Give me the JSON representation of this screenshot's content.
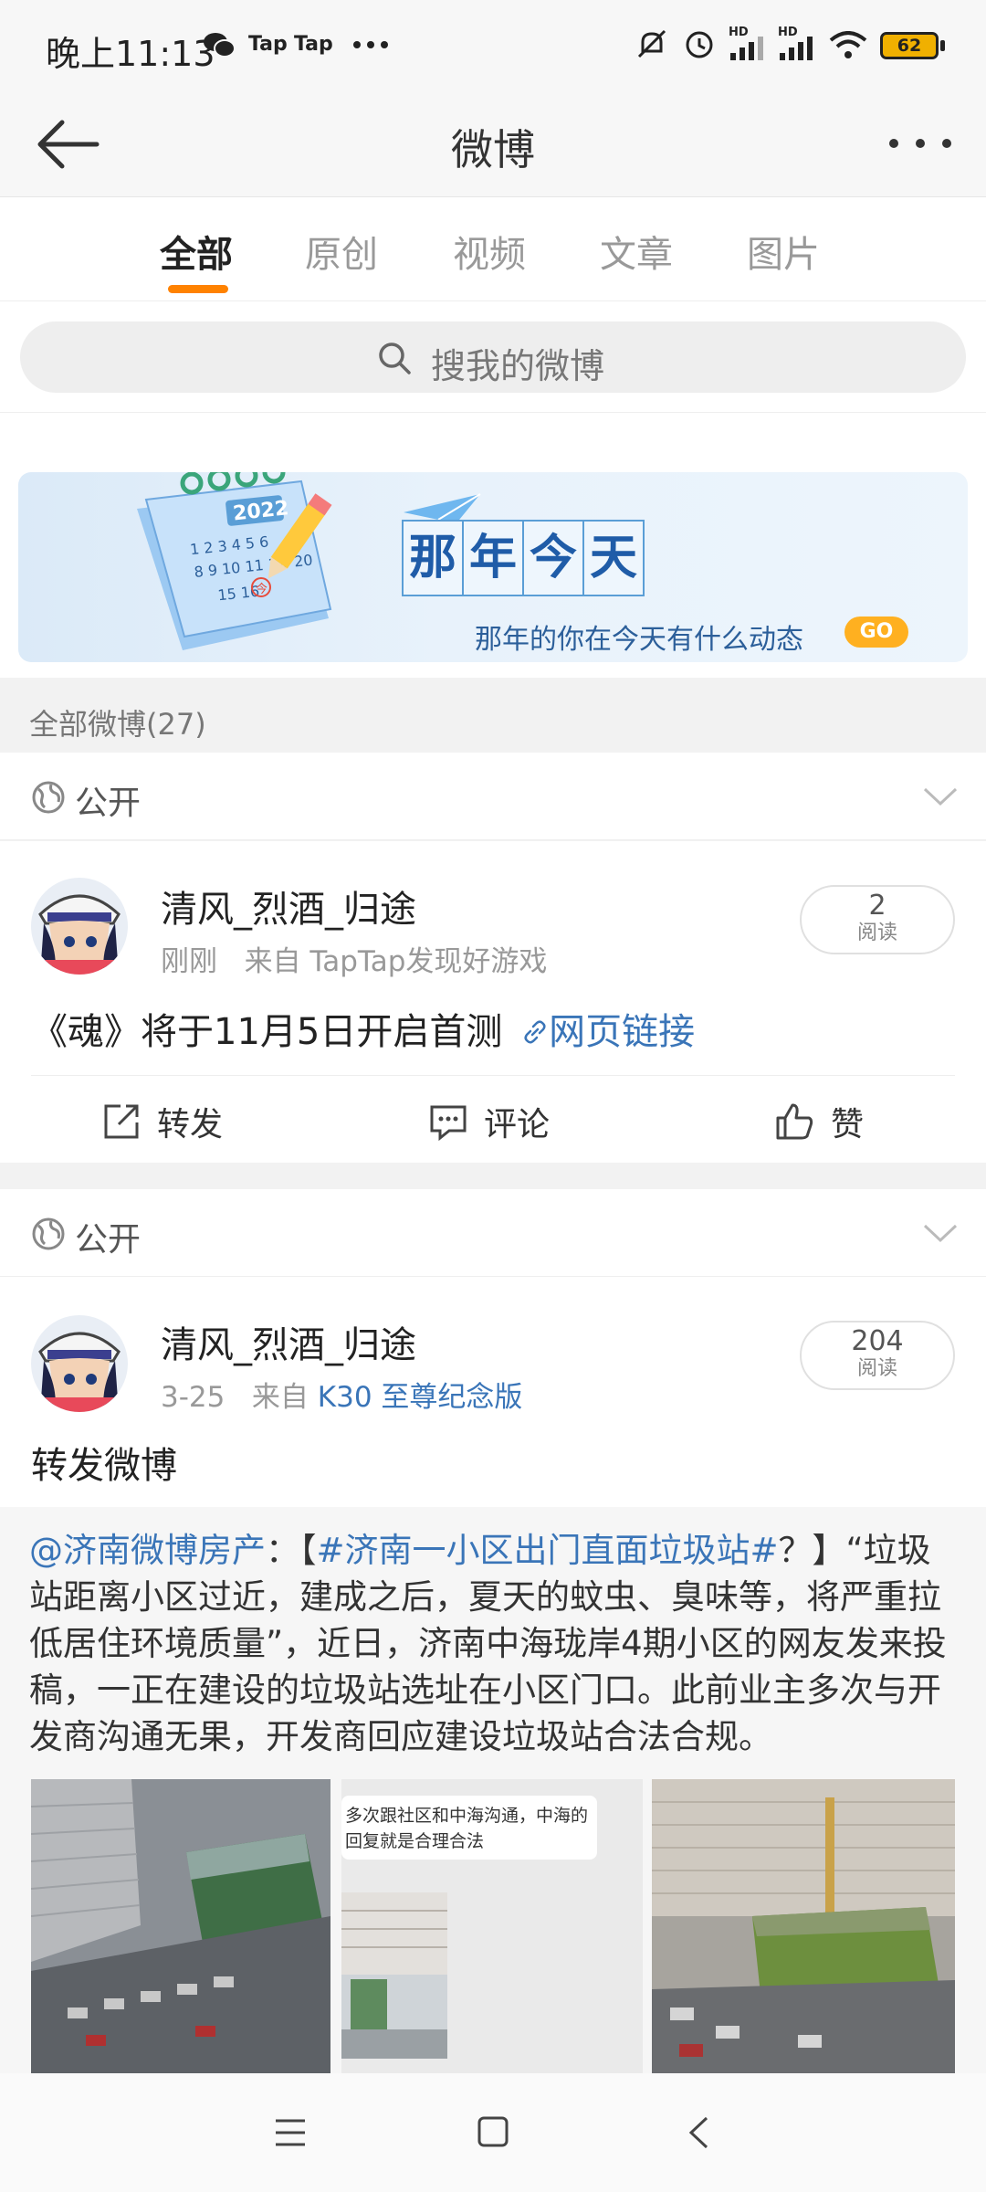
{
  "status_bar": {
    "time": "晚上11:13",
    "app_labels": [
      "Tap",
      "Tap"
    ],
    "hd_labels": [
      "HD",
      "HD"
    ],
    "battery": "62"
  },
  "nav": {
    "title": "微博"
  },
  "tabs": [
    {
      "label": "全部",
      "active": true
    },
    {
      "label": "原创",
      "active": false
    },
    {
      "label": "视频",
      "active": false
    },
    {
      "label": "文章",
      "active": false
    },
    {
      "label": "图片",
      "active": false
    }
  ],
  "search": {
    "placeholder": "搜我的微博"
  },
  "banner": {
    "calendar_year": "2022",
    "calendar_today_mark": "今",
    "title_chars": [
      "那",
      "年",
      "今",
      "天"
    ],
    "subtitle": "那年的你在今天有什么动态",
    "go_label": "GO"
  },
  "section": {
    "count_label": "全部微博(27)"
  },
  "posts": [
    {
      "visibility": "公开",
      "username": "清风_烈酒_归途",
      "time": "刚刚",
      "source_prefix": "来自",
      "source": "TapTap发现好游戏",
      "reads": "2",
      "reads_label": "阅读",
      "content": "《魂》将于11月5日开启首测",
      "link_label": "网页链接",
      "actions": {
        "repost": "转发",
        "comment": "评论",
        "like": "赞"
      }
    },
    {
      "visibility": "公开",
      "username": "清风_烈酒_归途",
      "time": "3-25",
      "source_prefix": "来自",
      "source": "K30 至尊纪念版",
      "reads": "204",
      "reads_label": "阅读",
      "content": "转发微博"
    }
  ],
  "repost": {
    "mention": "@济南微博房产",
    "colon": "：【",
    "hashtag": "#济南一小区出门直面垃圾站#",
    "body": "？】“垃圾站距离小区过近，建成之后，夏天的蚊虫、臭味等，将严重拉低居住环境质量”，近日，济南中海珑岸4期小区的网友发来投稿，一正在建设的垃圾站选址在小区门口。此前业主多次与开发商沟通无果，开发商回应建设垃圾站合法合规。",
    "image2_caption_line1": "多次跟社区和中海沟通，中海的",
    "image2_caption_line2": "回复就是合理合法"
  },
  "colors": {
    "accent": "#ff8200",
    "link": "#3a75b8",
    "banner_blue": "#1f5ca8",
    "go_yellow": "#ffb020"
  },
  "icons": [
    "back-arrow-icon",
    "more-icon",
    "search-icon",
    "globe-icon",
    "chevron-down-icon",
    "repost-icon",
    "comment-icon",
    "like-icon",
    "link-icon",
    "menu-icon",
    "home-icon",
    "back-icon"
  ]
}
